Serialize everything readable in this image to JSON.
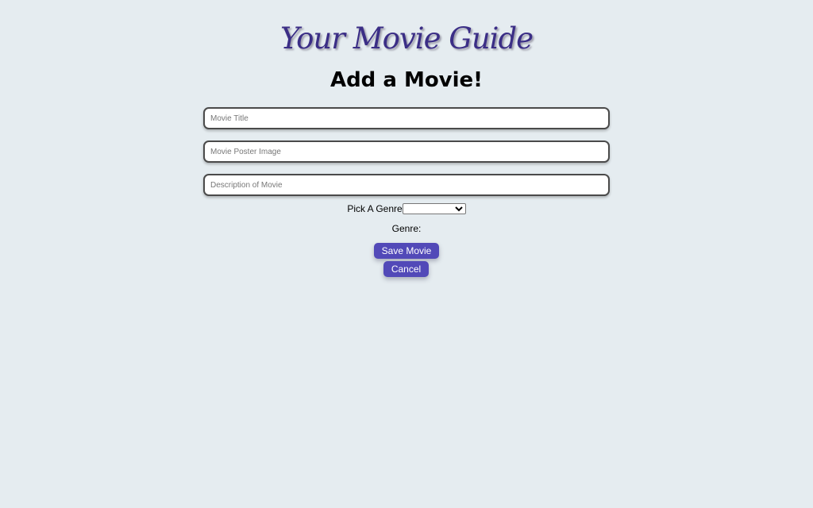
{
  "header": {
    "site_title": "Your Movie Guide",
    "page_heading": "Add a Movie!"
  },
  "form": {
    "title_placeholder": "Movie Title",
    "title_value": "",
    "poster_placeholder": "Movie Poster Image",
    "poster_value": "",
    "description_placeholder": "Description of Movie",
    "description_value": "",
    "genre_label": "Pick A Genre",
    "genre_selected": "",
    "genre_display_label": "Genre:",
    "genre_display_value": ""
  },
  "actions": {
    "save_label": "Save Movie",
    "cancel_label": "Cancel"
  },
  "colors": {
    "background": "#e5ecf0",
    "title_color": "#3b2e86",
    "button_bg": "#5249b8"
  }
}
